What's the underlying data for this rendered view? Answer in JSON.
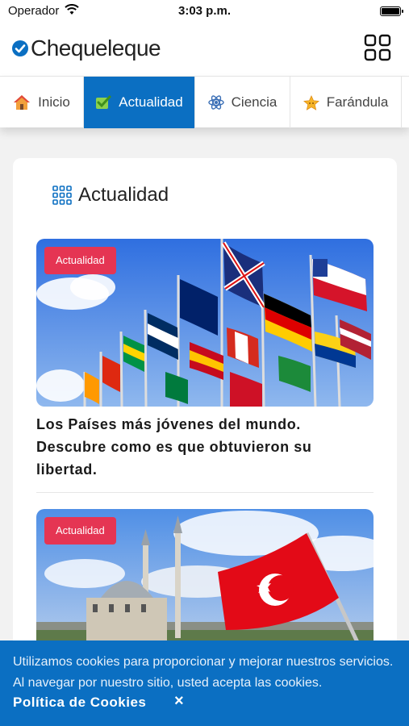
{
  "status_bar": {
    "carrier": "Operador",
    "time": "3:03 p.m."
  },
  "header": {
    "logo_text": "Chequeleque",
    "menu_icon": "grid-icon"
  },
  "nav": {
    "tabs": [
      {
        "label": "Inicio",
        "icon": "home-icon",
        "active": false
      },
      {
        "label": "Actualidad",
        "icon": "check-icon",
        "active": true
      },
      {
        "label": "Ciencia",
        "icon": "atom-icon",
        "active": false
      },
      {
        "label": "Farándula",
        "icon": "star-icon",
        "active": false
      }
    ]
  },
  "section": {
    "title": "Actualidad",
    "icon": "apps-icon"
  },
  "articles": [
    {
      "category": "Actualidad",
      "headline": "Los Países más jóvenes del mundo. Descubre como es que obtuvieron su libertad.",
      "image": "world-flags"
    },
    {
      "category": "Actualidad",
      "headline": "",
      "image": "turkey-flag-mosque"
    }
  ],
  "cookie_banner": {
    "text": "Utilizamos cookies para proporcionar y mejorar nuestros servicios. Al navegar por nuestro sitio, usted acepta las cookies.",
    "link": "Política de Cookies",
    "close": "×"
  },
  "colors": {
    "brand_blue": "#0b6fc2",
    "badge_red": "#e53553"
  }
}
